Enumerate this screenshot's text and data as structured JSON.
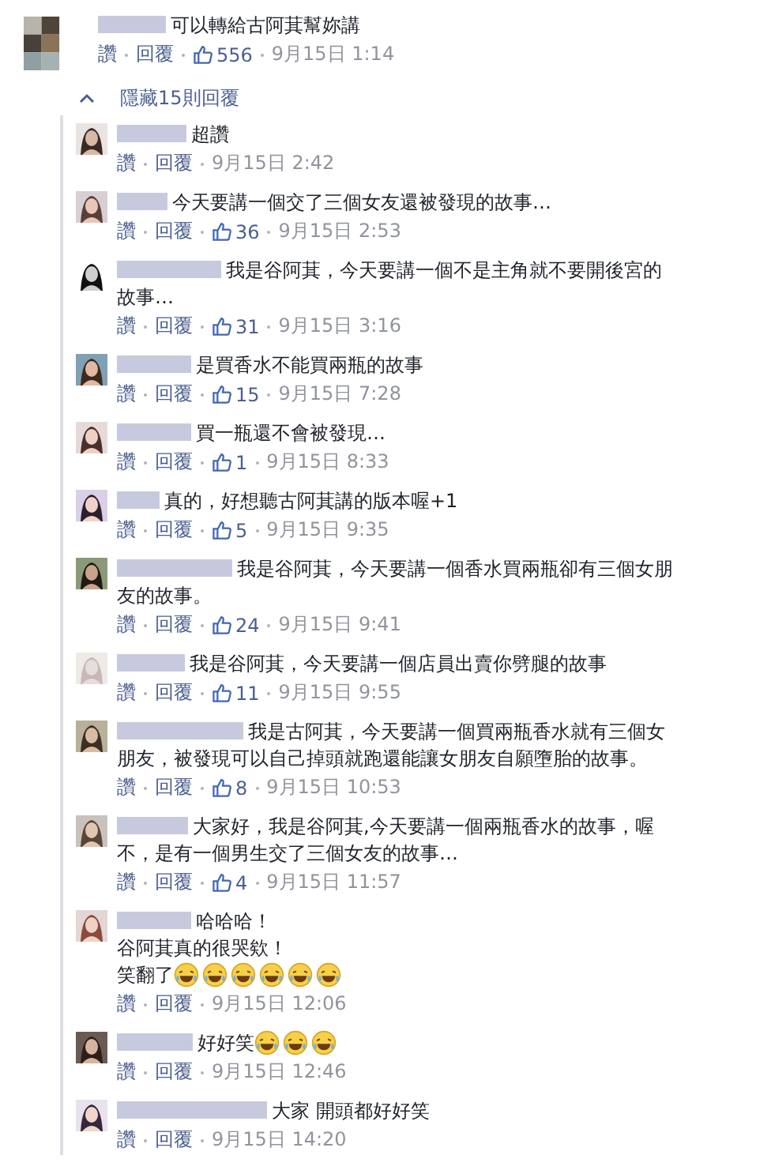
{
  "comment": {
    "text": "可以轉給古阿萁幫妳講",
    "actions": [
      "讚",
      "回覆"
    ],
    "likes": "556",
    "time": "9月15日 1:14"
  },
  "replies_toggle": {
    "label": "隱藏15則回覆",
    "expanded": true
  },
  "replies": [
    {
      "lines": [
        "超讚"
      ],
      "actions": [
        "讚",
        "回覆"
      ],
      "time": "9月15日 2:42"
    },
    {
      "lines": [
        "今天要講一個交了三個女友還被發現的故事…"
      ],
      "actions": [
        "讚",
        "回覆"
      ],
      "likes": "36",
      "time": "9月15日 2:53"
    },
    {
      "lines": [
        "我是谷阿萁，今天要講一個不是主角就不要開後宮的",
        "故事…"
      ],
      "actions": [
        "讚",
        "回覆"
      ],
      "likes": "31",
      "time": "9月15日 3:16"
    },
    {
      "lines": [
        "是買香水不能買兩瓶的故事"
      ],
      "actions": [
        "讚",
        "回覆"
      ],
      "likes": "15",
      "time": "9月15日 7:28"
    },
    {
      "lines": [
        "買一瓶還不會被發現…"
      ],
      "actions": [
        "讚",
        "回覆"
      ],
      "likes": "1",
      "time": "9月15日 8:33"
    },
    {
      "lines": [
        "真的，好想聽古阿萁講的版本喔+1"
      ],
      "actions": [
        "讚",
        "回覆"
      ],
      "likes": "5",
      "time": "9月15日 9:35"
    },
    {
      "lines": [
        "我是谷阿萁，今天要講一個香水買兩瓶卻有三個女朋",
        "友的故事。"
      ],
      "actions": [
        "讚",
        "回覆"
      ],
      "likes": "24",
      "time": "9月15日 9:41"
    },
    {
      "lines": [
        "我是谷阿萁，今天要講一個店員出賣你劈腿的故事"
      ],
      "actions": [
        "讚",
        "回覆"
      ],
      "likes": "11",
      "time": "9月15日 9:55"
    },
    {
      "lines": [
        "我是古阿萁，今天要講一個買兩瓶香水就有三個女",
        "朋友，被發現可以自己掉頭就跑還能讓女朋友自願墮胎的故事。"
      ],
      "actions": [
        "讚",
        "回覆"
      ],
      "likes": "8",
      "time": "9月15日 10:53"
    },
    {
      "lines": [
        "大家好，我是谷阿萁,今天要講一個兩瓶香水的故事，喔",
        "不，是有一個男生交了三個女友的故事…"
      ],
      "actions": [
        "讚",
        "回覆"
      ],
      "likes": "4",
      "time": "9月15日 11:57"
    },
    {
      "lines": [
        "哈哈哈！",
        "谷阿萁真的很哭欸！",
        "笑翻了"
      ],
      "emoji": [
        {
          "kind": "tears-of-joy"
        },
        {
          "kind": "tears-of-joy"
        },
        {
          "kind": "tears-of-joy"
        },
        {
          "kind": "tears-of-joy"
        },
        {
          "kind": "tears-of-joy"
        },
        {
          "kind": "tears-of-joy"
        }
      ],
      "actions": [
        "讚",
        "回覆"
      ],
      "time": "9月15日 12:06"
    },
    {
      "lines": [
        "好好笑"
      ],
      "emoji": [
        {
          "kind": "tears-of-joy"
        },
        {
          "kind": "tears-of-joy"
        },
        {
          "kind": "tears-of-joy"
        }
      ],
      "actions": [
        "讚",
        "回覆"
      ],
      "time": "9月15日 12:46"
    },
    {
      "lines": [
        "大家 開頭都好好笑"
      ],
      "actions": [
        "讚",
        "回覆"
      ],
      "time": "9月15日 14:20"
    }
  ]
}
